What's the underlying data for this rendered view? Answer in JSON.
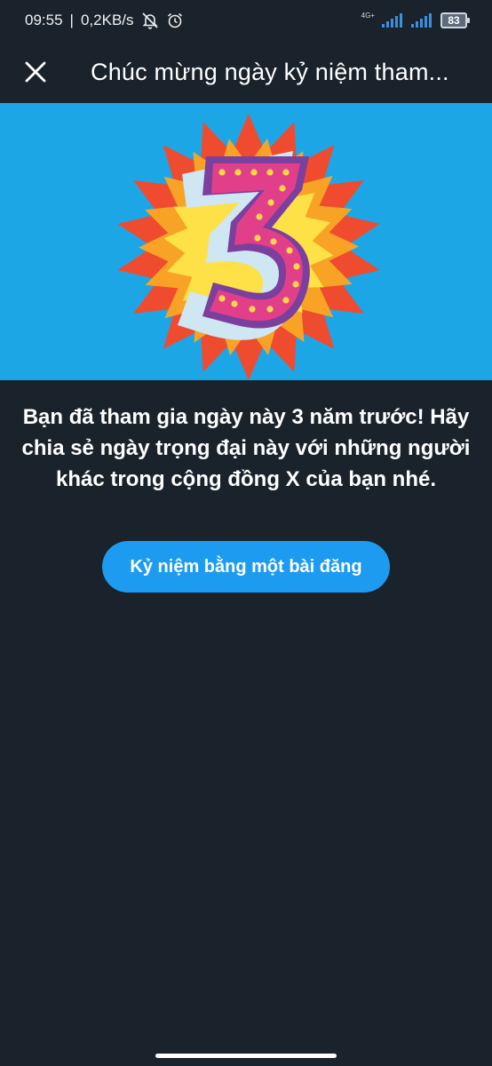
{
  "status_bar": {
    "time": "09:55",
    "speed": "0,2KB/s",
    "network_type": "4G+",
    "battery": "83",
    "icons": [
      "muted-bell-icon",
      "alarm-icon",
      "signal-icon",
      "signal-icon",
      "battery-icon"
    ]
  },
  "header": {
    "close_icon": "close-icon",
    "title": "Chúc mừng ngày kỷ niệm tham..."
  },
  "hero": {
    "graphic": "number-3-starburst",
    "colors": {
      "background": "#1da6e6",
      "number": "#e23f8a",
      "outline": "#7b3f9e",
      "burst_outer": "#ef4b2f",
      "burst_mid": "#f8a326",
      "burst_inner": "#fde146"
    }
  },
  "message": {
    "text": "Bạn đã tham gia ngày này 3 năm trước! Hãy chia sẻ ngày trọng đại này với những người khác trong cộng đồng X của bạn nhé."
  },
  "cta": {
    "label": "Kỷ niệm bằng một bài đăng",
    "color": "#1d9bf0"
  },
  "colors": {
    "background": "#1a222c"
  }
}
